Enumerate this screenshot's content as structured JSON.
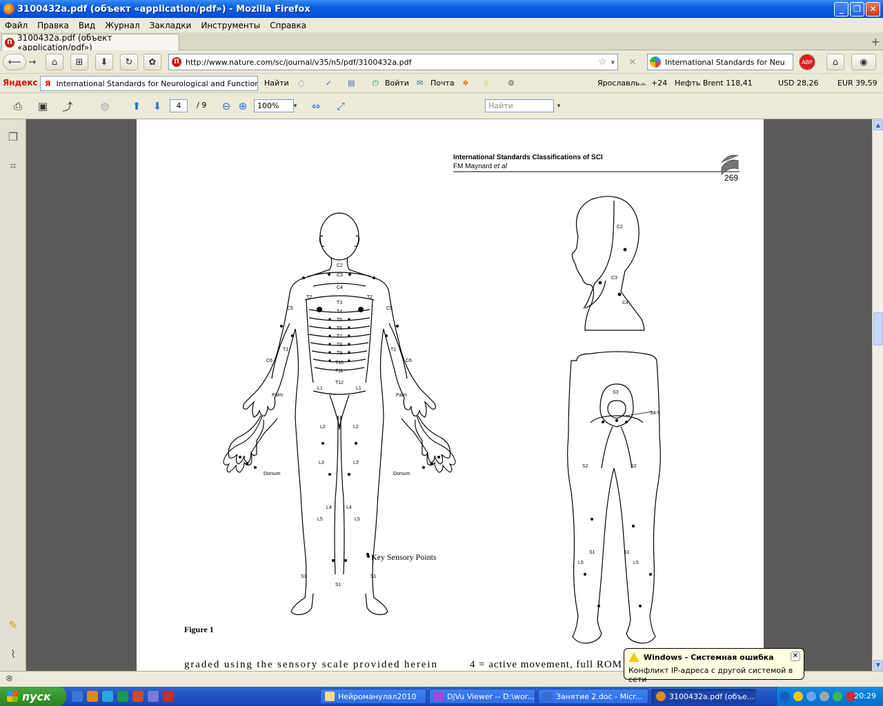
{
  "window": {
    "title": "3100432a.pdf (объект «application/pdf») - Mozilla Firefox"
  },
  "menu": [
    "Файл",
    "Правка",
    "Вид",
    "Журнал",
    "Закладки",
    "Инструменты",
    "Справка"
  ],
  "tab": {
    "label": "3100432a.pdf (объект «application/pdf»)",
    "new_tab": "+"
  },
  "nav": {
    "url": "http://www.nature.com/sc/journal/v35/n5/pdf/3100432a.pdf",
    "search_value": "International Standards for Neu"
  },
  "yandex": {
    "logo": "Яндекс",
    "input_value": "International Standards for Neurological and Function",
    "find": "Найти",
    "login": "Войти",
    "mail": "Почта",
    "city": "Ярославль",
    "temp": "+24",
    "oil": "Нефть Brent 118,41",
    "usd": "USD 28,26",
    "eur": "EUR 39,59"
  },
  "pdf": {
    "page": "4",
    "total": "/ 9",
    "zoom": "100%",
    "find_placeholder": "Найти"
  },
  "doc": {
    "header_title": "International Standards Classifications of SCI",
    "header_authors": "FM Maynard",
    "header_etal": "et al",
    "page_number": "269",
    "figure_caption": "Figure 1",
    "key_points": "Key Sensory Points",
    "body_left": "graded using the sensory scale provided herein",
    "body_right": "4 = active movement, full ROM",
    "labels": {
      "c2": "C2",
      "c3": "C3",
      "c4": "C4",
      "c5": "C5",
      "c6": "C6",
      "t1": "T1",
      "t2": "T2",
      "t3": "T3",
      "t4": "T4",
      "t5": "T5",
      "t6": "T6",
      "t7": "T7",
      "t8": "T8",
      "t9": "T9",
      "t10": "T10",
      "t11": "T11",
      "t12": "T12",
      "l1": "L1",
      "l2": "L2",
      "l3": "L3",
      "l4": "L4",
      "l5": "L5",
      "s1": "S1",
      "s2": "S2",
      "s3": "S3",
      "s45": "S4-5",
      "palm": "Palm",
      "dorsum": "Dorsum"
    }
  },
  "taskbar": {
    "start": "пуск",
    "items": [
      "Нейроманулал2010",
      "DjVu Viewer -- D:\\wor...",
      "Занятие 2.doc - Micr...",
      "3100432a.pdf (объе..."
    ],
    "clock": "20:29"
  },
  "balloon": {
    "title": "Windows - Системная ошибка",
    "message": "Конфликт IP-адреса с другой системой в сети"
  }
}
